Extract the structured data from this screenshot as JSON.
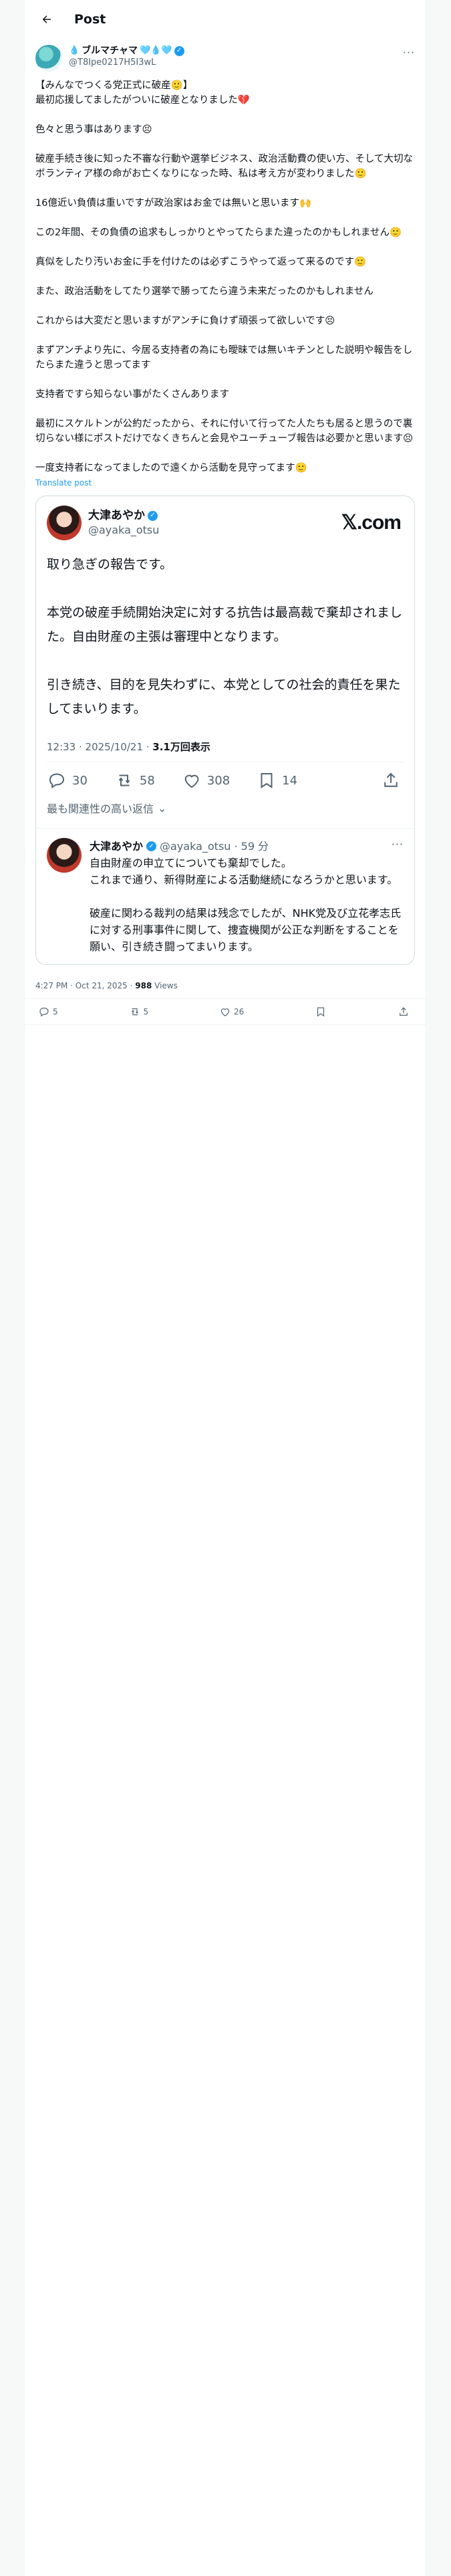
{
  "header": {
    "title": "Post"
  },
  "author": {
    "name": "ブルマチャマ",
    "handle": "@T8Ipe0217H5I3wL",
    "badges": "🩵💧🩵"
  },
  "post": {
    "paragraphs": [
      "【みんなでつくる党正式に破産🙂】\n最初応援してましたがついに破産となりました💔",
      "色々と思う事はあります😣",
      "破産手続き後に知った不審な行動や選挙ビジネス、政治活動費の使い方、そして大切なボランティア様の命がお亡くなりになった時、私は考え方が変わりました🙂",
      "16億近い負債は重いですが政治家はお金では無いと思います🙌",
      "この2年間、その負債の追求もしっかりとやってたらまた違ったのかもしれません🙂",
      "真似をしたり汚いお金に手を付けたのは必ずこうやって返って来るのです🙂",
      "また、政治活動をしてたり選挙で勝ってたら違う未来だったのかもしれません",
      "これからは大変だと思いますがアンチに負けず頑張って欲しいです😣",
      "まずアンチより先に、今居る支持者の為にも曖昧では無いキチンとした説明や報告をしたらまた違うと思ってます",
      "支持者ですら知らない事がたくさんあります",
      "最初にスケルトンが公約だったから、それに付いて行ってた人たちも居ると思うので裏切らない様にポストだけでなくきちんと会見やユーチューブ報告は必要かと思います😣",
      "一度支持者になってましたので遠くから活動を見守ってます🙂"
    ],
    "translate_label": "Translate post"
  },
  "quote": {
    "name": "大津あやか",
    "handle": "@ayaka_otsu",
    "brand": "𝕏.com",
    "paragraphs": [
      "取り急ぎの報告です。",
      "本党の破産手続開始決定に対する抗告は最高裁で棄却されました。自由財産の主張は審理中となります。",
      "引き続き、目的を見失わずに、本党としての社会的責任を果たしてまいります。"
    ],
    "timestamp": "12:33 · 2025/10/21 · ",
    "views": "3.1万回表示",
    "replies": "30",
    "reposts": "58",
    "likes": "308",
    "bookmarks": "14",
    "relevant_label": "最も関連性の高い返信"
  },
  "reply": {
    "name": "大津あやか",
    "handle": "@ayaka_otsu · 59 分",
    "paragraphs": [
      "自由財産の申立てについても棄却でした。\nこれまで通り、新得財産による活動継続になろうかと思います。",
      "破産に関わる裁判の結果は残念でしたが、NHK党及び立花孝志氏に対する刑事事件に関して、捜査機関が公正な判断をすることを願い、引き続き闘ってまいります。"
    ]
  },
  "meta": {
    "time": "4:27 PM · Oct 21, 2025 · ",
    "views_count": "988",
    "views_label": " Views"
  },
  "actions": {
    "replies": "5",
    "reposts": "5",
    "likes": "26"
  },
  "colors": {
    "accent": "#1d9bf0",
    "muted": "#536471",
    "text": "#0f1419"
  }
}
